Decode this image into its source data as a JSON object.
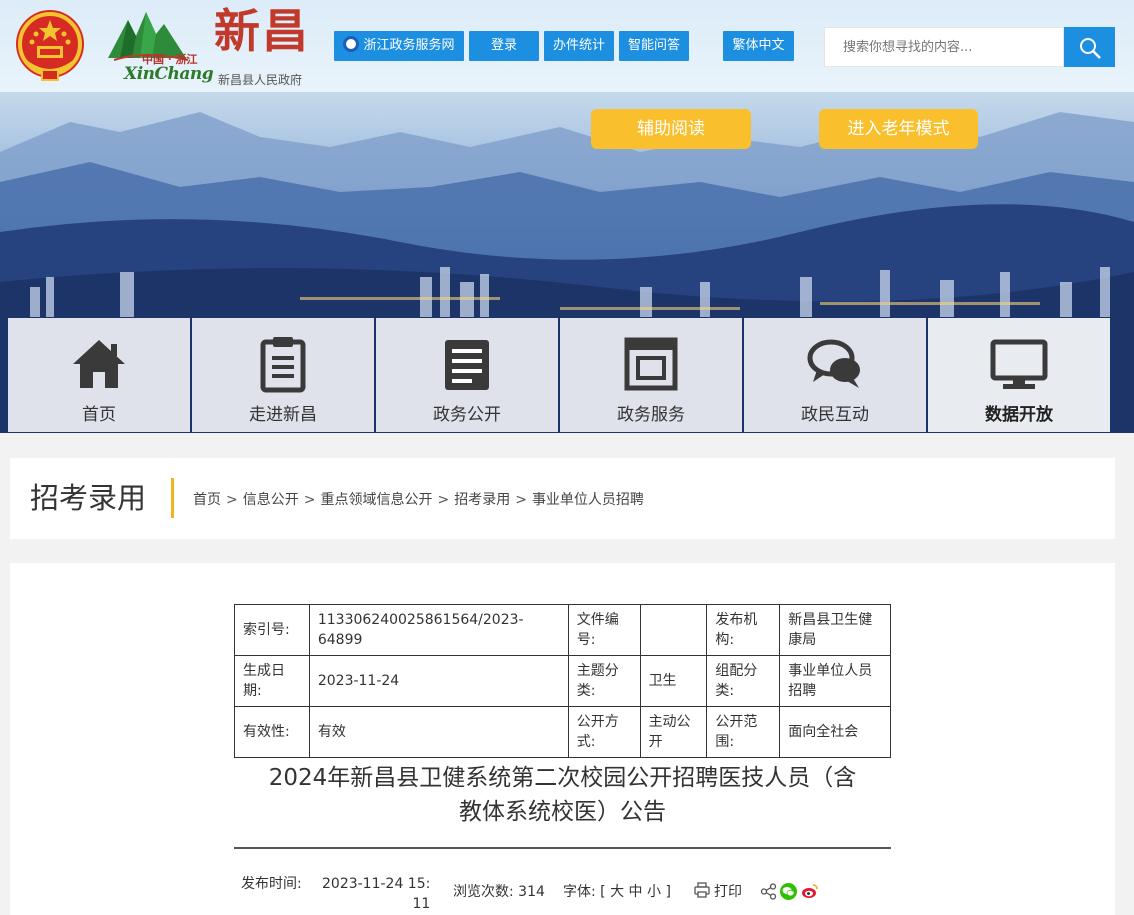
{
  "header": {
    "logo_country": "中国 · 浙江",
    "logo_en": "XinChang",
    "logo_big": "新昌",
    "logo_sub": "新昌县人民政府",
    "links": [
      "浙江政务服务网",
      "登录",
      "办件统计",
      "智能问答",
      "繁体中文"
    ],
    "search_placeholder": "搜索你想寻找的内容..."
  },
  "banner": {
    "assist_reading": "辅助阅读",
    "elder_mode": "进入老年模式"
  },
  "nav": {
    "items": [
      {
        "label": "首页",
        "icon": "home-icon"
      },
      {
        "label": "走进新昌",
        "icon": "clipboard-icon"
      },
      {
        "label": "政务公开",
        "icon": "document-icon"
      },
      {
        "label": "政务服务",
        "icon": "service-frame-icon"
      },
      {
        "label": "政民互动",
        "icon": "chat-bubbles-icon"
      },
      {
        "label": "数据开放",
        "icon": "monitor-icon"
      }
    ]
  },
  "section": {
    "title": "招考录用",
    "breadcrumbs": [
      "首页",
      "信息公开",
      "重点领域信息公开",
      "招考录用",
      "事业单位人员招聘"
    ]
  },
  "meta": {
    "index_label": "索引号:",
    "index_value": "113306240025861564/2023-64899",
    "docno_label": "文件编号:",
    "docno_value": "",
    "publisher_label": "发布机构:",
    "publisher_value": "新昌县卫生健康局",
    "date_label": "生成日期:",
    "date_value": "2023-11-24",
    "topic_label": "主题分类:",
    "topic_value": "卫生",
    "group_label": "组配分类:",
    "group_value": "事业单位人员招聘",
    "validity_label": "有效性:",
    "validity_value": "有效",
    "method_label": "公开方式:",
    "method_value": "主动公开",
    "scope_label": "公开范围:",
    "scope_value": "面向全社会"
  },
  "article": {
    "title_line1": "2024年新昌县卫健系统第二次校园公开招聘医技人员（含",
    "title_line2": "教体系统校医）公告",
    "publish_label": "发布时间:",
    "publish_time_line1": "2023-11-24 15:",
    "publish_time_line2": "11",
    "views": "浏览次数: 314",
    "font_label": "字体: [",
    "font_big": "大",
    "font_mid": "中",
    "font_small": "小",
    "font_close": "]",
    "print": "打印"
  },
  "colors": {
    "primary_blue": "#1d8fe0",
    "accent_yellow": "#f9bf2c",
    "page_bg": "#f2f2f2"
  }
}
